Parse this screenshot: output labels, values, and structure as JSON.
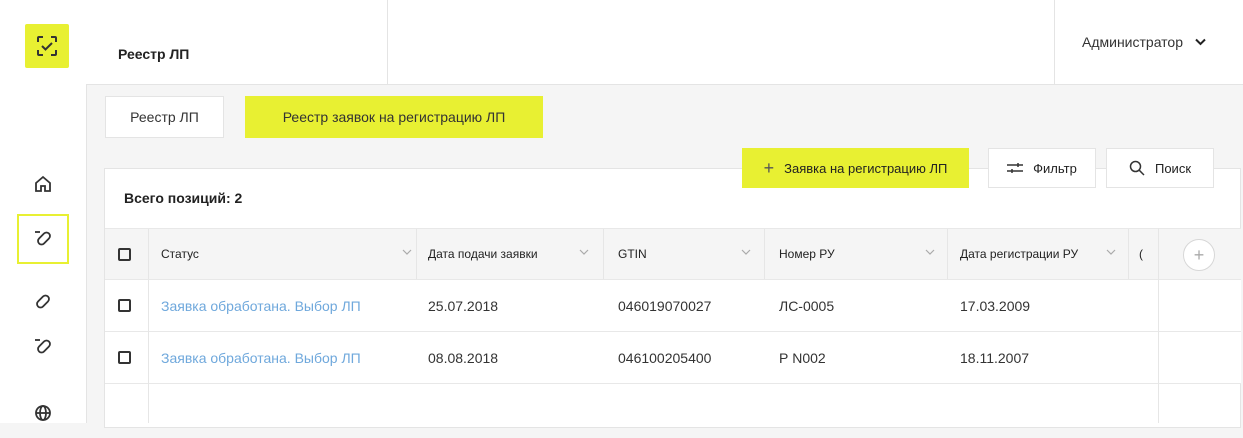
{
  "header": {
    "title": "Реестр ЛП",
    "user": "Администратор"
  },
  "sidebar": {
    "items": [
      {
        "icon": "home-icon"
      },
      {
        "icon": "pill-crossed-icon",
        "active": true
      },
      {
        "icon": "pill-icon"
      },
      {
        "icon": "pill-crossed-icon"
      },
      {
        "icon": "globe-icon"
      }
    ]
  },
  "tabs": [
    {
      "label": "Реестр ЛП",
      "active": false
    },
    {
      "label": "Реестр заявок на регистрацию ЛП",
      "active": true
    }
  ],
  "toolbar": {
    "total_label": "Всего позиций: 2",
    "add_label": "Заявка на регистрацию ЛП",
    "filter_label": "Фильтр",
    "search_label": "Поиск"
  },
  "table": {
    "columns": [
      "Статус",
      "Дата подачи заявки",
      "GTIN",
      "Номер РУ",
      "Дата регистрации РУ",
      "("
    ],
    "rows": [
      {
        "status": "Заявка обработана. Выбор ЛП",
        "date": "25.07.2018",
        "gtin": "046019070027",
        "ru": "ЛС-0005",
        "ru_date": "17.03.2009"
      },
      {
        "status": "Заявка обработана. Выбор ЛП",
        "date": "08.08.2018",
        "gtin": "046100205400",
        "ru": "Р N002",
        "ru_date": "18.11.2007"
      }
    ]
  },
  "colors": {
    "accent": "#e8f032",
    "link": "#6fa8dc"
  }
}
